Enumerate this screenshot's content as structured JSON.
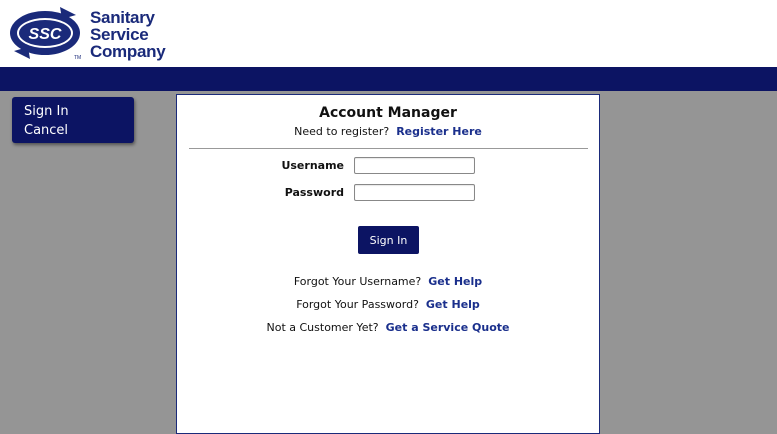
{
  "logo": {
    "monogram": "SSC",
    "trademark": "TM",
    "name_lines": [
      "Sanitary",
      "Service",
      "Company"
    ]
  },
  "sidebar": {
    "items": [
      {
        "label": "Sign In"
      },
      {
        "label": "Cancel"
      }
    ]
  },
  "panel": {
    "title": "Account Manager",
    "register_prompt": "Need to register?",
    "register_link": "Register Here",
    "username_label": "Username",
    "username_value": "",
    "password_label": "Password",
    "password_value": "",
    "signin_button": "Sign In",
    "help": [
      {
        "prompt": "Forgot Your Username?",
        "link": "Get Help"
      },
      {
        "prompt": "Forgot Your Password?",
        "link": "Get Help"
      },
      {
        "prompt": "Not a Customer Yet?",
        "link": "Get a Service Quote"
      }
    ]
  },
  "colors": {
    "brand_navy": "#0c1463",
    "link_blue": "#1a2f8c",
    "background_gray": "#959595"
  }
}
